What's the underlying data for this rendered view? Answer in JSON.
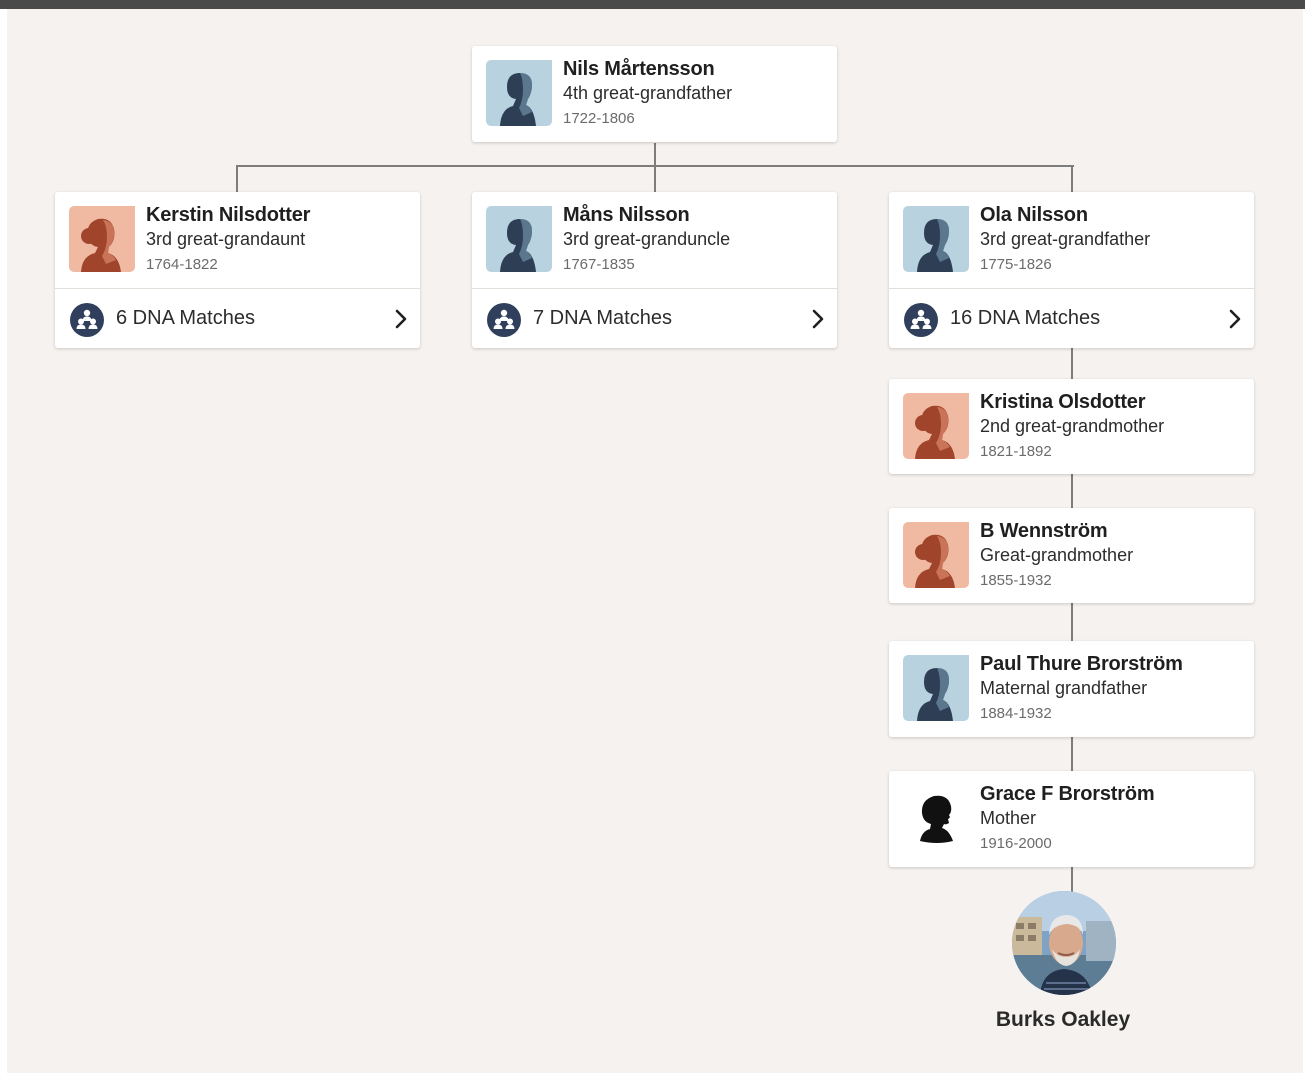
{
  "people": {
    "nils": {
      "name": "Nils Mårtensson",
      "relationship": "4th great-grandfather",
      "dates": "1722-1806",
      "avatar": "male-avatar-icon"
    },
    "kerstin": {
      "name": "Kerstin Nilsdotter",
      "relationship": "3rd great-grandaunt",
      "dates": "1764-1822",
      "avatar": "female-avatar-icon",
      "dna_label": "6 DNA Matches"
    },
    "mans": {
      "name": "Måns Nilsson",
      "relationship": "3rd great-granduncle",
      "dates": "1767-1835",
      "avatar": "male-avatar-icon",
      "dna_label": "7 DNA Matches"
    },
    "ola": {
      "name": "Ola Nilsson",
      "relationship": "3rd great-grandfather",
      "dates": "1775-1826",
      "avatar": "male-avatar-icon",
      "dna_label": "16 DNA Matches"
    },
    "kristina": {
      "name": "Kristina Olsdotter",
      "relationship": "2nd great-grandmother",
      "dates": "1821-1892",
      "avatar": "female-avatar-icon"
    },
    "b": {
      "name": "B Wennström",
      "relationship": "Great-grandmother",
      "dates": "1855-1932",
      "avatar": "female-avatar-icon"
    },
    "paul": {
      "name": "Paul Thure Brorström",
      "relationship": "Maternal grandfather",
      "dates": "1884-1932",
      "avatar": "male-avatar-icon"
    },
    "grace": {
      "name": "Grace F Brorström",
      "relationship": "Mother",
      "dates": "1916-2000",
      "avatar": "silhouette-avatar-icon"
    }
  },
  "self": {
    "name": "Burks Oakley",
    "avatar": "user-photo"
  },
  "icons": {
    "dna": "dna-matches-icon",
    "chevron": "chevron-right-icon"
  },
  "colors": {
    "background": "#f5f2ef",
    "card": "#ffffff",
    "connector": "#7d7d7d",
    "male_bg": "#b8d2e0",
    "male_figure": "#2d3e55",
    "female_bg": "#f0b9a1",
    "female_figure": "#a1442c",
    "dna_icon_bg": "#2f3f5c",
    "top_bar": "#4a4a4a"
  }
}
